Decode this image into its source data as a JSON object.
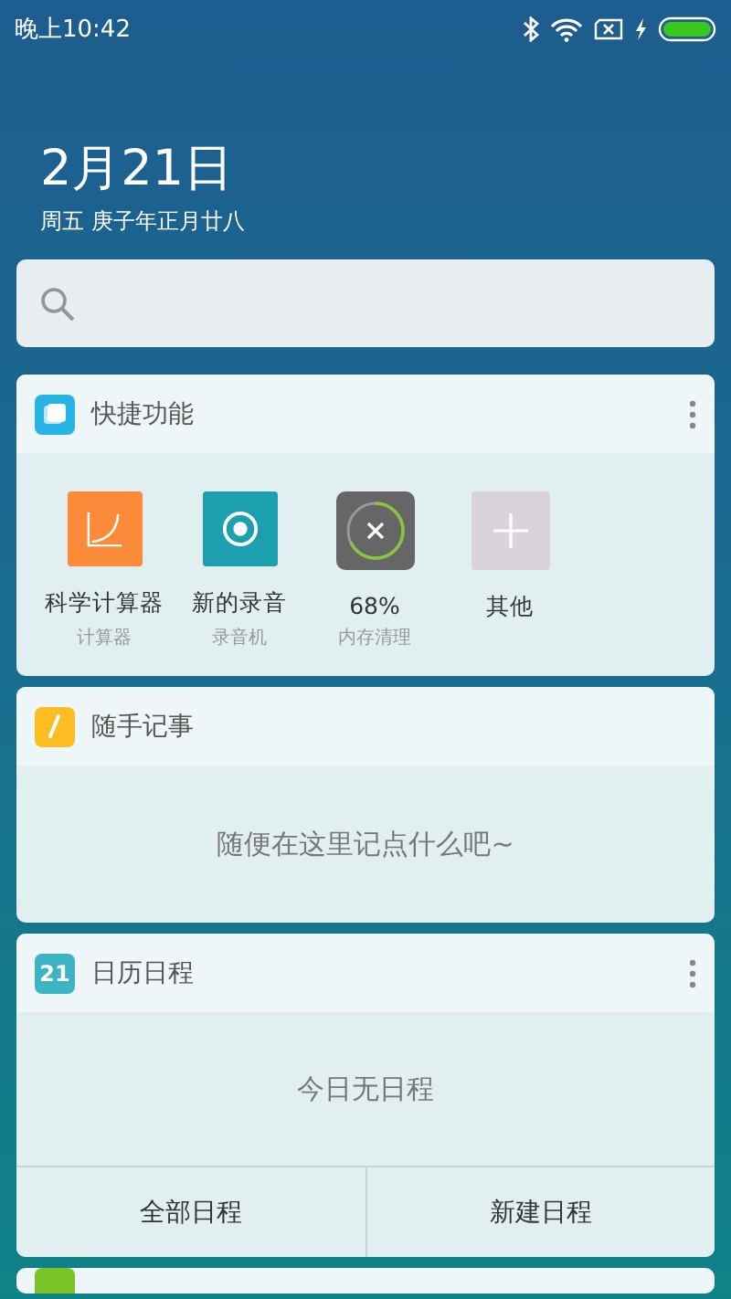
{
  "status_bar": {
    "time": "晚上10:42"
  },
  "date": {
    "day": "2月21日",
    "detail": "周五 庚子年正月廿八"
  },
  "widgets": [
    {
      "kind": "shortcuts",
      "title": "快捷功能",
      "has_menu": true,
      "items": [
        {
          "kind": "calculator",
          "label": "科学计算器",
          "sublabel": "计算器"
        },
        {
          "kind": "recorder",
          "label": "新的录音",
          "sublabel": "录音机"
        },
        {
          "kind": "cleaner",
          "label": "68%",
          "sublabel": "内存清理",
          "level": 0.68
        },
        {
          "kind": "add",
          "label": "其他"
        }
      ]
    },
    {
      "kind": "notes",
      "title": "随手记事",
      "has_menu": false,
      "hint": "随便在这里记点什么吧~"
    },
    {
      "kind": "calendar",
      "title": "日历日程",
      "icon_text": "21",
      "has_menu": true,
      "message": "今日无日程",
      "buttons": [
        "全部日程",
        "新建日程"
      ]
    },
    {
      "kind": "partial"
    }
  ]
}
